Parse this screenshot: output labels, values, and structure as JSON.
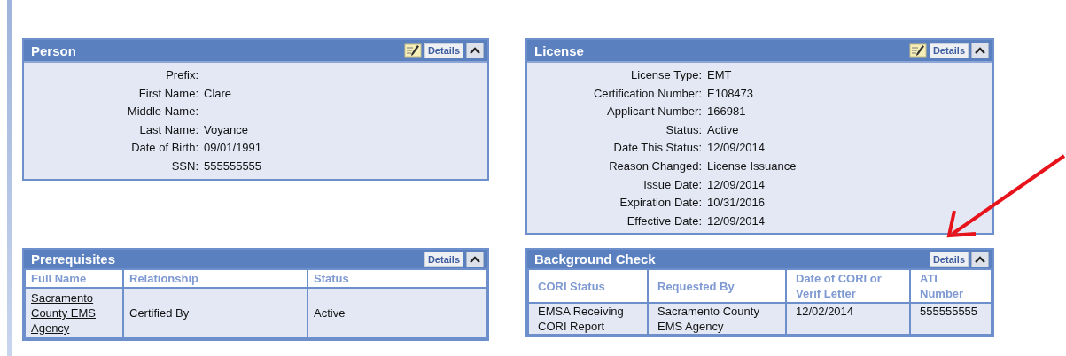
{
  "panels": [
    {
      "kind": "fields",
      "title": "Person",
      "editable": true,
      "expanded": true,
      "details": "Details",
      "fields": [
        {
          "label": "Prefix:"
        },
        {
          "label": "First Name:",
          "value": "Clare"
        },
        {
          "label": "Middle Name:"
        },
        {
          "label": "Last Name:",
          "value": "Voyance"
        },
        {
          "label": "Date of Birth:",
          "value": "09/01/1991"
        },
        {
          "label": "SSN:",
          "value": "555555555"
        }
      ]
    },
    {
      "kind": "fields",
      "title": "License",
      "editable": true,
      "expanded": true,
      "details": "Details",
      "fields": [
        {
          "label": "License Type:",
          "value": "EMT"
        },
        {
          "label": "Certification Number:",
          "value": "E108473"
        },
        {
          "label": "Applicant Number:",
          "value": "166981"
        },
        {
          "label": "Status:",
          "value": "Active"
        },
        {
          "label": "Date This Status:",
          "value": "12/09/2014"
        },
        {
          "label": "Reason Changed:",
          "value": "License Issuance"
        },
        {
          "label": "Issue Date:",
          "value": "12/09/2014"
        },
        {
          "label": "Expiration Date:",
          "value": "10/31/2016"
        },
        {
          "label": "Effective Date:",
          "value": "12/09/2014"
        }
      ]
    },
    {
      "kind": "table",
      "title": "Prerequisites",
      "editable": false,
      "expanded": true,
      "details": "Details",
      "columns": [
        "Full Name",
        "Relationship",
        "Status"
      ],
      "rows": [
        [
          {
            "text": "Sacramento County EMS Agency",
            "link": true
          },
          {
            "text": "Certified By",
            "link": false
          },
          {
            "text": "Active",
            "link": false
          }
        ]
      ]
    },
    {
      "kind": "table",
      "title": "Background Check",
      "editable": false,
      "expanded": true,
      "details": "Details",
      "columns": [
        "CORI Status",
        "Requested By",
        "Date of CORI or Verif Letter",
        "ATI Number"
      ],
      "rows": [
        [
          {
            "text": "EMSA Receiving CORI Report",
            "link": false
          },
          {
            "text": "Sacramento County EMS Agency",
            "link": false
          },
          {
            "text": "12/02/2014",
            "link": false
          },
          {
            "text": "555555555",
            "link": false
          }
        ]
      ]
    }
  ]
}
